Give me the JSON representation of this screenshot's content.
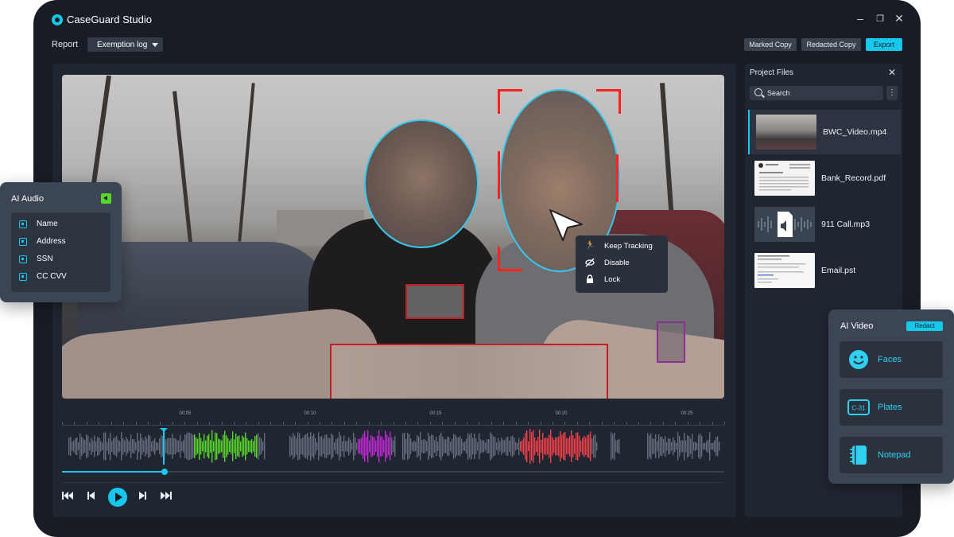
{
  "app": {
    "title": "CaseGuard Studio"
  },
  "window_controls": {
    "minimize": "–",
    "restore": "❐",
    "close": "✕"
  },
  "toolbar": {
    "report_label": "Report",
    "dropdown_value": "Exemption log",
    "marked_copy": "Marked Copy",
    "redacted_copy": "Redacted Copy",
    "export": "Export"
  },
  "context_menu": {
    "items": [
      {
        "icon": "running-person-icon",
        "label": "Keep Tracking"
      },
      {
        "icon": "eye-off-icon",
        "label": "Disable"
      },
      {
        "icon": "lock-icon",
        "label": "Lock"
      }
    ]
  },
  "timeline": {
    "labels": [
      "00:05",
      "00:10",
      "00:15",
      "00:20",
      "00:25"
    ],
    "progress": 0.155
  },
  "project_files": {
    "title": "Project Files",
    "search_placeholder": "Search",
    "files": [
      {
        "name": "BWC_Video.mp4",
        "type": "video",
        "active": true
      },
      {
        "name": "Bank_Record.pdf",
        "type": "document",
        "active": false
      },
      {
        "name": "911 Call.mp3",
        "type": "audio",
        "active": false
      },
      {
        "name": "Email.pst",
        "type": "email",
        "active": false
      }
    ]
  },
  "ai_audio": {
    "title": "AI Audio",
    "items": [
      "Name",
      "Address",
      "SSN",
      "CC CVV"
    ]
  },
  "ai_video": {
    "title": "AI Video",
    "redact": "Redact",
    "options": [
      {
        "icon": "face-icon",
        "label": "Faces"
      },
      {
        "icon": "license-plate-icon",
        "label": "Plates",
        "icon_text": "C-31"
      },
      {
        "icon": "notepad-icon",
        "label": "Notepad"
      }
    ]
  },
  "colors": {
    "accent": "#17c8ec",
    "window_bg": "#181d25",
    "panel_bg": "#202631",
    "redaction_red": "#c41e24",
    "tracking_blue": "#36c9ef",
    "audio_green": "#58d62a",
    "audio_purple": "#c227d8",
    "audio_red": "#f0404a"
  }
}
